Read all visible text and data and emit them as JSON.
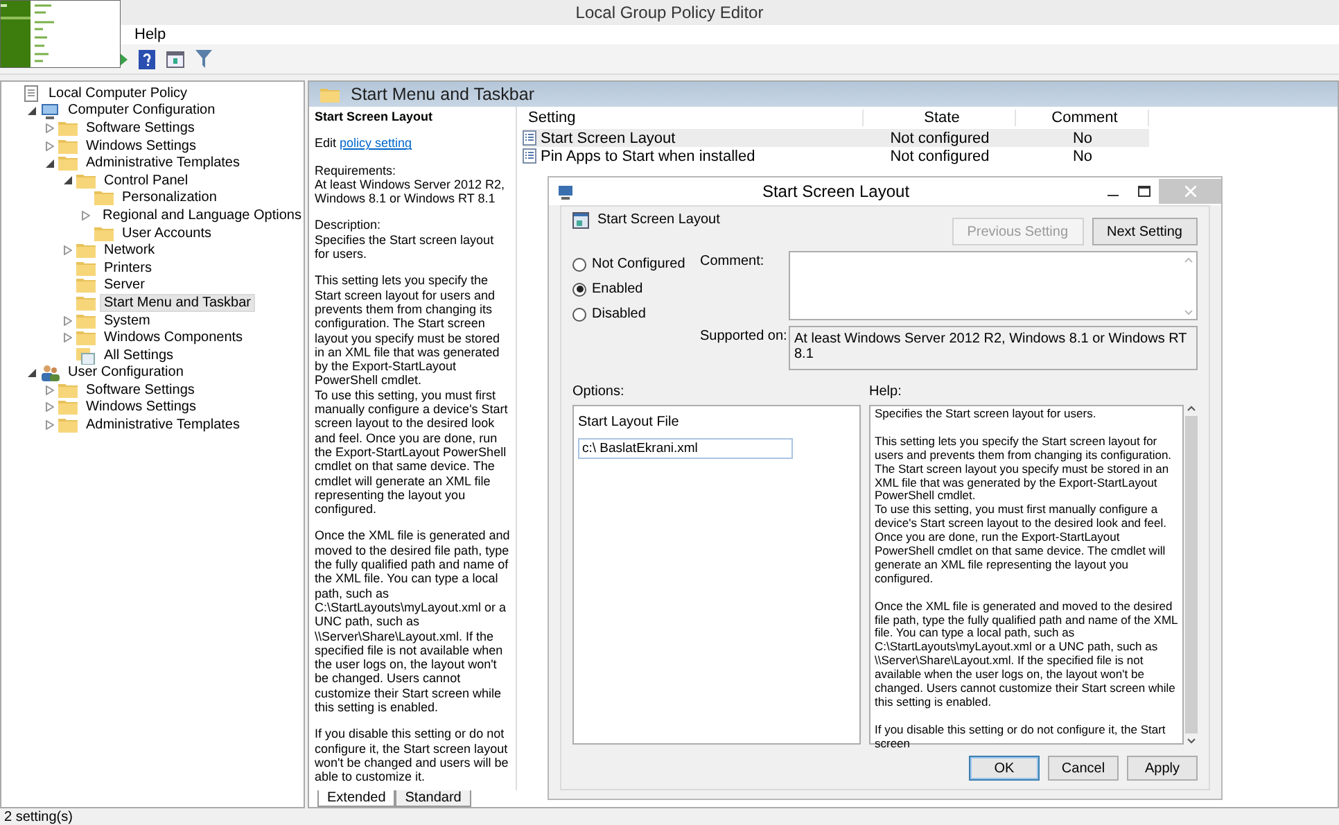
{
  "window": {
    "title": "Local Group Policy Editor"
  },
  "thumbnail": {
    "kind": "picture"
  },
  "menu": [
    "Help"
  ],
  "toolbar": [
    {
      "kind": "forward"
    },
    {
      "kind": "help"
    },
    {
      "kind": "pane"
    },
    {
      "kind": "filter"
    }
  ],
  "tree": [
    {
      "label": "Local Computer Policy",
      "kind": "policy",
      "selected": false,
      "children": [
        {
          "label": "Computer Configuration",
          "kind": "computer",
          "expanded": true,
          "selected": false,
          "children": [
            {
              "label": "Software Settings",
              "kind": "folder",
              "expanded": false,
              "selected": false
            },
            {
              "label": "Windows Settings",
              "kind": "folder",
              "expanded": false,
              "selected": false
            },
            {
              "label": "Administrative Templates",
              "kind": "folder",
              "expanded": true,
              "selected": false,
              "children": [
                {
                  "label": "Control Panel",
                  "kind": "folder",
                  "expanded": true,
                  "selected": false,
                  "children": [
                    {
                      "label": "Personalization",
                      "kind": "folder",
                      "selected": false
                    },
                    {
                      "label": "Regional and Language Options",
                      "kind": "folder",
                      "expanded": false,
                      "selected": false
                    },
                    {
                      "label": "User Accounts",
                      "kind": "folder",
                      "selected": false
                    }
                  ]
                },
                {
                  "label": "Network",
                  "kind": "folder",
                  "expanded": false,
                  "selected": false
                },
                {
                  "label": "Printers",
                  "kind": "folder",
                  "selected": false
                },
                {
                  "label": "Server",
                  "kind": "folder",
                  "selected": false
                },
                {
                  "label": "Start Menu and Taskbar",
                  "kind": "folder",
                  "selected": true
                },
                {
                  "label": "System",
                  "kind": "folder",
                  "expanded": false,
                  "selected": false
                },
                {
                  "label": "Windows Components",
                  "kind": "folder",
                  "expanded": false,
                  "selected": false
                },
                {
                  "label": "All Settings",
                  "kind": "settings",
                  "selected": false
                }
              ]
            }
          ]
        },
        {
          "label": "User Configuration",
          "kind": "user",
          "expanded": true,
          "selected": false,
          "children": [
            {
              "label": "Software Settings",
              "kind": "folder",
              "expanded": false,
              "selected": false
            },
            {
              "label": "Windows Settings",
              "kind": "folder",
              "expanded": false,
              "selected": false
            },
            {
              "label": "Administrative Templates",
              "kind": "folder",
              "expanded": false,
              "selected": false
            }
          ]
        }
      ]
    }
  ],
  "pane_header": "Start Menu and Taskbar",
  "description": {
    "title": "Start Screen Layout",
    "edit_prefix": "Edit",
    "edit_link": "policy setting",
    "blocks": [
      [
        "Requirements:",
        "At least Windows Server 2012 R2, Windows 8.1 or Windows RT 8.1"
      ],
      [
        "Description:",
        "Specifies the Start screen layout for users."
      ],
      [
        "This setting lets you specify the Start screen layout for users and prevents them from changing its configuration. The Start screen layout you specify must be stored in an XML file that was generated by the Export-StartLayout PowerShell cmdlet.",
        "To use this setting, you must first manually configure a device's Start screen layout to the desired look and feel. Once you are  done, run the Export-StartLayout PowerShell cmdlet on that same device. The cmdlet will generate an XML file representing the layout you configured."
      ],
      [
        "Once the XML file is generated and moved to the desired file path, type the fully qualified path and name of the XML file. You can type a local path, such as C:\\StartLayouts\\myLayout.xml or a UNC path, such as \\\\Server\\Share\\Layout.xml. If the specified file is not available when the user logs on, the layout won't be changed. Users cannot customize their Start screen while this setting is enabled."
      ],
      [
        "If you disable this setting or do not configure it, the Start screen layout won't be changed and users will be able to customize it."
      ]
    ]
  },
  "table": {
    "columns": [
      "Setting",
      "State",
      "Comment"
    ],
    "rows": [
      {
        "cells": [
          "Start Screen Layout",
          "Not configured",
          "No"
        ],
        "selected": true
      },
      {
        "cells": [
          "Pin Apps to Start when installed",
          "Not configured",
          "No"
        ],
        "selected": false
      }
    ]
  },
  "view_tabs": [
    {
      "label": "Extended",
      "selected": true
    },
    {
      "label": "Standard",
      "selected": false
    }
  ],
  "status_bar": "2 setting(s)",
  "dialog": {
    "title": "Start Screen Layout",
    "setting_name": "Start Screen Layout",
    "nav_buttons": [
      {
        "label": "Previous Setting",
        "disabled": true
      },
      {
        "label": "Next Setting",
        "disabled": false
      }
    ],
    "radios": [
      {
        "label": "Not Configured",
        "selected": false
      },
      {
        "label": "Enabled",
        "selected": true
      },
      {
        "label": "Disabled",
        "selected": false
      }
    ],
    "comment_label": "Comment:",
    "supported_label": "Supported on:",
    "supported_text": "At least Windows Server 2012 R2, Windows 8.1 or Windows RT 8.1",
    "options_label": "Options:",
    "help_label": "Help:",
    "option_field_label": "Start Layout File",
    "option_field_value": "c:\\ BaslatEkrani.xml",
    "help_blocks": [
      [
        "Specifies the Start screen layout for users."
      ],
      [
        "This setting lets you specify the Start screen layout for users and prevents them from changing its configuration. The Start screen layout you specify must be stored in an XML file that was generated by the Export-StartLayout PowerShell cmdlet.",
        "To use this setting, you must first manually configure a device's Start screen layout to the desired look and feel. Once you are done, run the Export-StartLayout PowerShell cmdlet on that same device. The cmdlet will generate an XML file representing the layout you configured."
      ],
      [
        "Once the XML file is generated and moved to the desired file path, type the fully qualified path and name of the XML file. You can type a local path, such as C:\\StartLayouts\\myLayout.xml or a UNC path, such as \\\\Server\\Share\\Layout.xml. If the specified file is not available when the user logs on, the layout won't be changed. Users cannot customize their Start screen while this setting is enabled."
      ],
      [
        "If you disable this setting or do not configure it, the Start screen"
      ]
    ],
    "buttons": [
      {
        "label": "OK",
        "default": true
      },
      {
        "label": "Cancel",
        "default": false
      },
      {
        "label": "Apply",
        "default": false
      }
    ]
  }
}
